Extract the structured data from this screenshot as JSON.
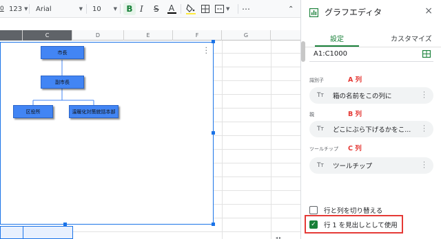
{
  "toolbar": {
    "zero_fmt": "0",
    "number_fmt": "123",
    "font": "Arial",
    "font_size": "10",
    "bold": "B",
    "italic": "I",
    "strike": "S",
    "text_color": "A"
  },
  "grid": {
    "columns": [
      "C",
      "D",
      "E",
      "F",
      "G"
    ],
    "selected_column": "C"
  },
  "chart": {
    "nodes": [
      {
        "label": "市長"
      },
      {
        "label": "副市長"
      },
      {
        "label": "区役所"
      },
      {
        "label": "温暖化対策統括本部"
      }
    ],
    "node_color": "#4285f4",
    "border_color": "#1a73e8"
  },
  "panel": {
    "title": "グラフエディタ",
    "close": "×",
    "tabs": [
      "設定",
      "カスタマイズ"
    ],
    "active_tab": "設定",
    "range": "A1:C1000",
    "sections": [
      {
        "label": "識別子",
        "column": "A 列",
        "value": "箱の名前をこの列に"
      },
      {
        "label": "親",
        "column": "B 列",
        "value": "どこにぶら下げるかをこ..."
      },
      {
        "label": "ツールチップ",
        "column": "C 列",
        "value": "ツールチップ"
      }
    ],
    "switch_rows_cols": "行と列を切り替える",
    "use_header": "行 1 を見出しとして使用",
    "switch_checked": false,
    "header_checked": true,
    "accent_color": "#188038",
    "highlight_color": "#e53935"
  }
}
